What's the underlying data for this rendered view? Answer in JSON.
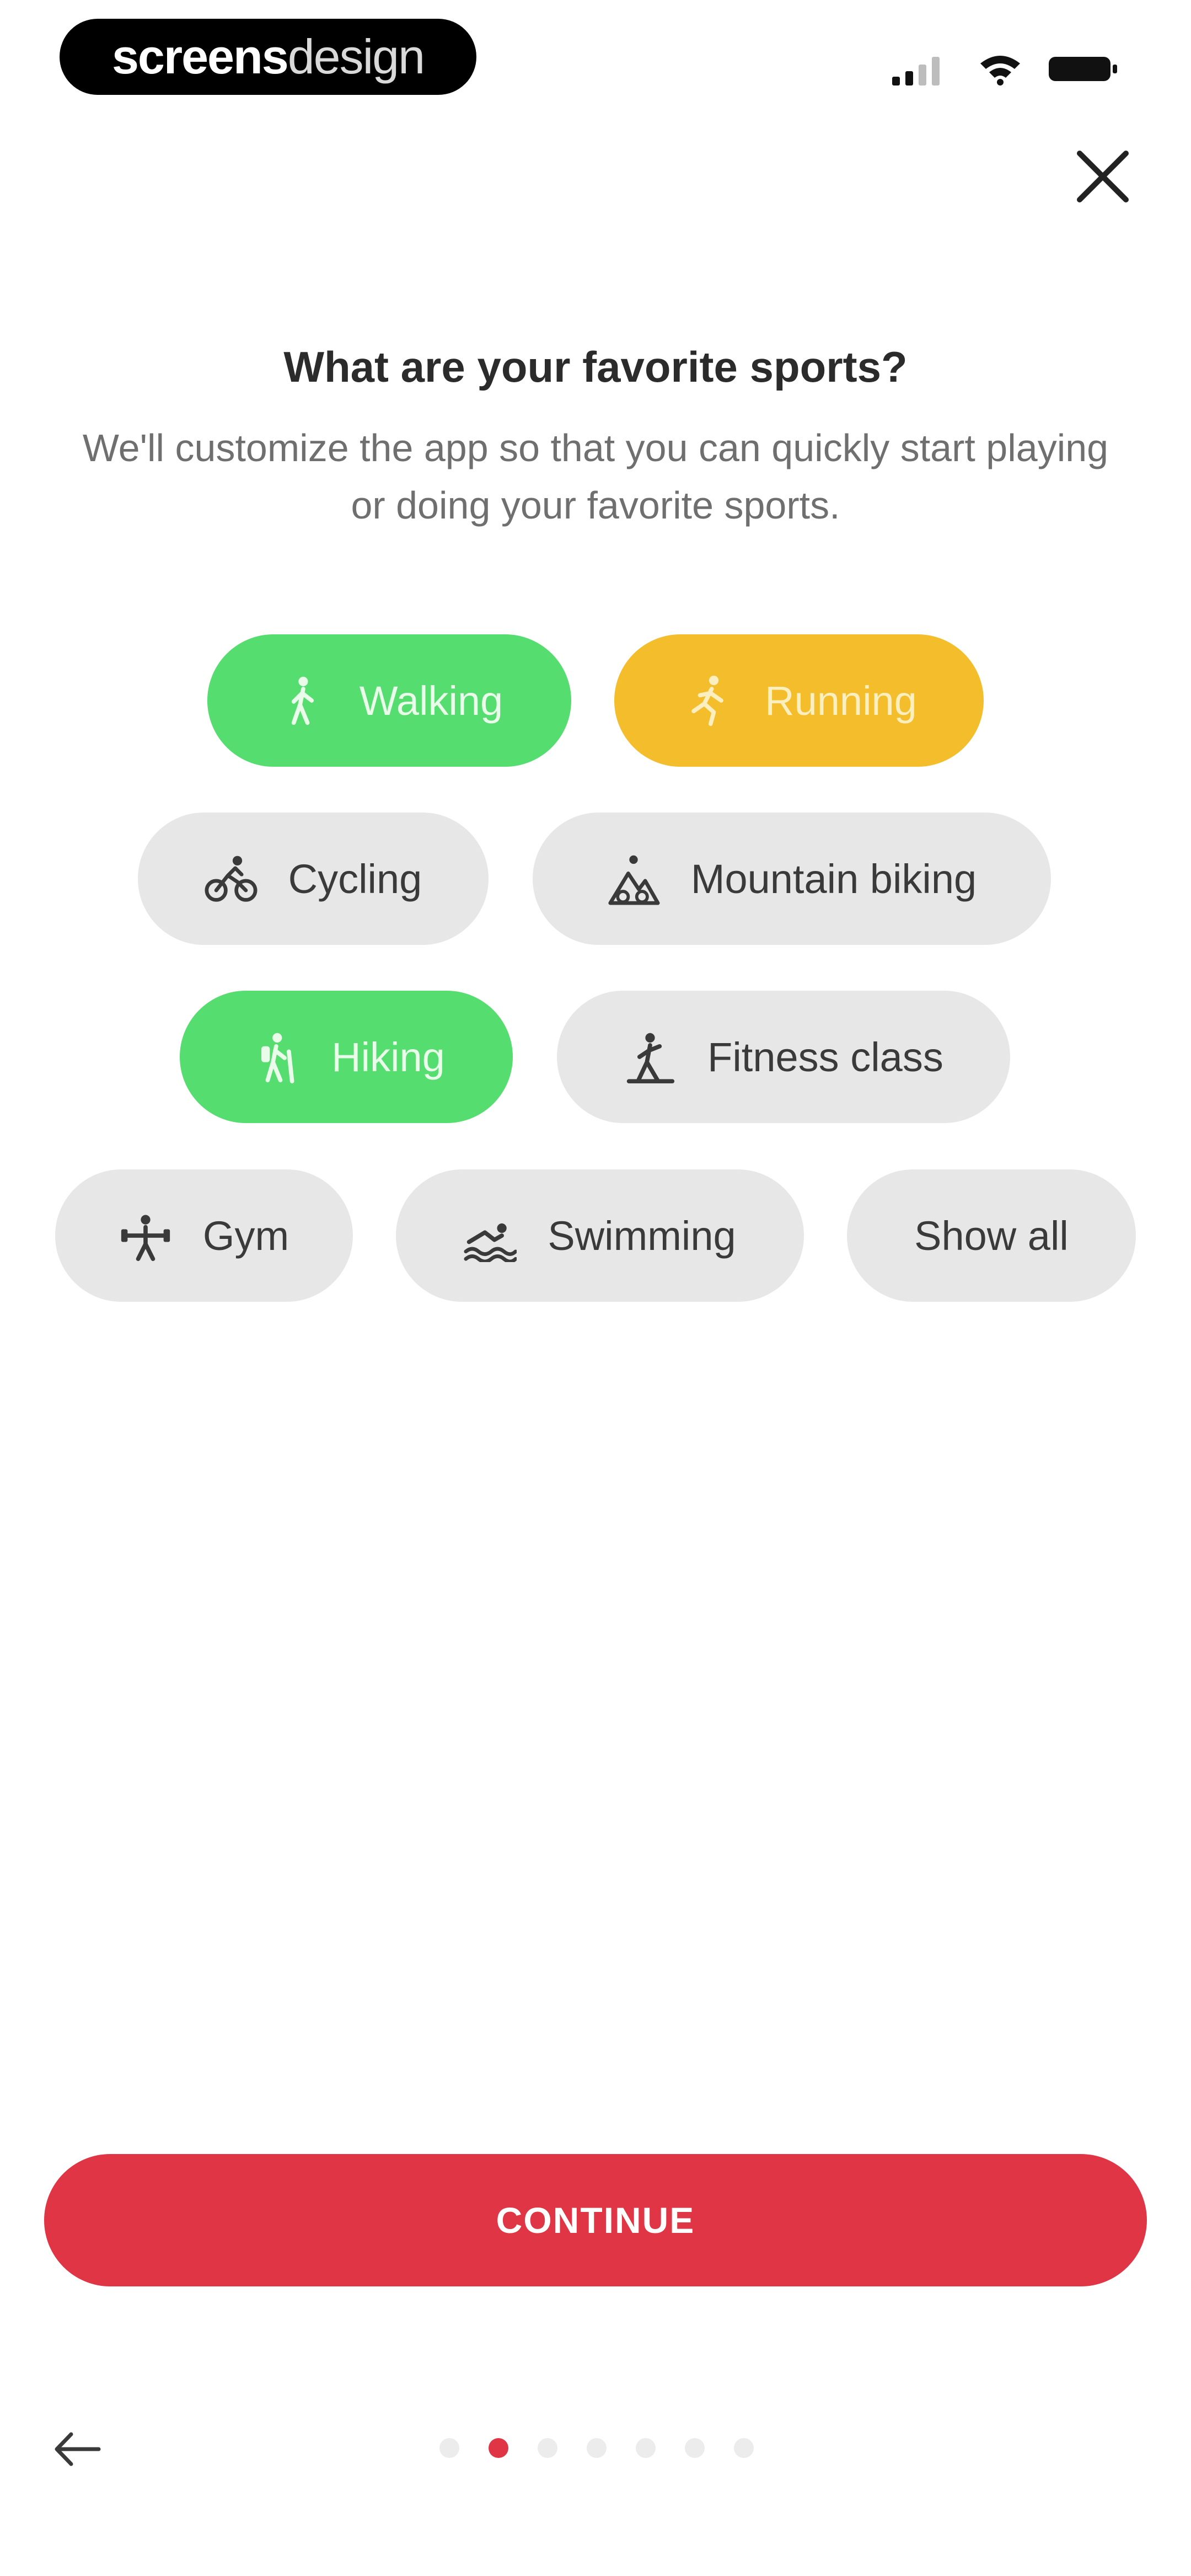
{
  "status_bar": {
    "brand_strong": "screens",
    "brand_light": "design",
    "icons": [
      "signal-icon",
      "wifi-icon",
      "battery-icon"
    ]
  },
  "header": {
    "close_icon": "close-icon"
  },
  "title": "What are your favorite sports?",
  "subtitle": "We'll customize the app so that you can quickly start playing or doing your favorite sports.",
  "sports": {
    "walking": {
      "label": "Walking",
      "icon": "walking-icon",
      "selected": true,
      "color": "#55dd70"
    },
    "running": {
      "label": "Running",
      "icon": "running-icon",
      "selected": true,
      "color": "#f4bd2b"
    },
    "cycling": {
      "label": "Cycling",
      "icon": "cycling-icon",
      "selected": false
    },
    "mountain_biking": {
      "label": "Mountain biking",
      "icon": "mountain-biking-icon",
      "selected": false
    },
    "hiking": {
      "label": "Hiking",
      "icon": "hiking-icon",
      "selected": true,
      "color": "#55dd70"
    },
    "fitness_class": {
      "label": "Fitness class",
      "icon": "fitness-class-icon",
      "selected": false
    },
    "gym": {
      "label": "Gym",
      "icon": "gym-icon",
      "selected": false
    },
    "swimming": {
      "label": "Swimming",
      "icon": "swimming-icon",
      "selected": false
    },
    "show_all": {
      "label": "Show all"
    }
  },
  "continue_label": "CONTINUE",
  "pager": {
    "total": 7,
    "current": 2,
    "active_color": "#df3545"
  },
  "back_icon": "arrow-left-icon",
  "colors": {
    "accent": "#df3545",
    "green": "#55dd70",
    "yellow": "#f4bd2b",
    "chip_bg": "#e7e7e7"
  }
}
